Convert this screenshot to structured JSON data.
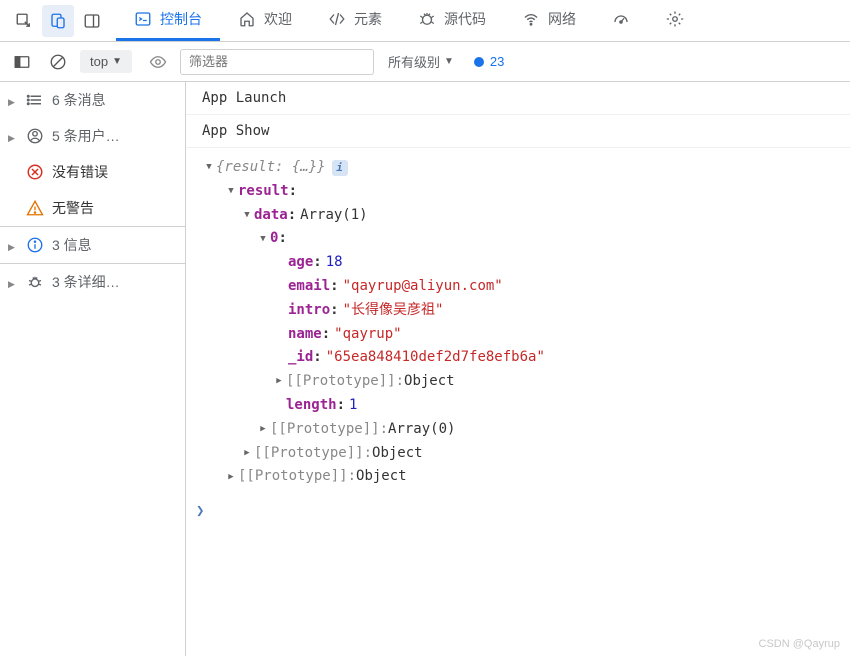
{
  "topbar": {
    "tabs": [
      {
        "label": "控制台"
      },
      {
        "label": "欢迎"
      },
      {
        "label": "元素"
      },
      {
        "label": "源代码"
      },
      {
        "label": "网络"
      }
    ]
  },
  "filterbar": {
    "context": "top",
    "filter_placeholder": "筛选器",
    "level_label": "所有级别",
    "message_count": "23"
  },
  "sidebar": {
    "items": [
      {
        "label": "6 条消息"
      },
      {
        "label": "5 条用户…"
      },
      {
        "label": "没有错误"
      },
      {
        "label": "无警告"
      },
      {
        "label": "3 信息"
      },
      {
        "label": "3 条详细…"
      }
    ]
  },
  "console": {
    "lines": [
      "App Launch",
      "App Show"
    ],
    "obj": {
      "summary": "{result: {…}}",
      "result_key": "result",
      "data_key": "data",
      "data_type": "Array(1)",
      "index0": "0",
      "fields": {
        "age_k": "age",
        "age_v": "18",
        "email_k": "email",
        "email_v": "\"qayrup@aliyun.com\"",
        "intro_k": "intro",
        "intro_v": "\"长得像吴彦祖\"",
        "name_k": "name",
        "name_v": "\"qayrup\"",
        "id_k": "_id",
        "id_v": "\"65ea848410def2d7fe8efb6a\""
      },
      "proto_key": "[[Prototype]]",
      "proto_obj": "Object",
      "length_k": "length",
      "length_v": "1",
      "proto_arr": "Array(0)"
    }
  },
  "watermark": "CSDN @Qayrup"
}
